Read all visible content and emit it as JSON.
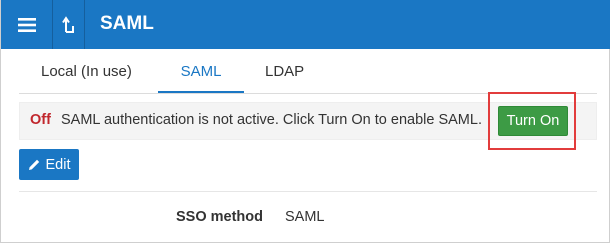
{
  "header": {
    "title": "SAML",
    "color": "#1a77c4"
  },
  "tabs": [
    {
      "label": "Local (In use)",
      "active": false
    },
    {
      "label": "SAML",
      "active": true
    },
    {
      "label": "LDAP",
      "active": false
    }
  ],
  "banner": {
    "status": "Off",
    "message": "SAML authentication is not active. Click Turn On to enable SAML.",
    "action_label": "Turn On"
  },
  "toolbar": {
    "edit_label": "Edit"
  },
  "settings": {
    "sso_method_label": "SSO method",
    "sso_method_value": "SAML"
  },
  "icons": {
    "menu": "hamburger-icon",
    "back": "back-arrow-icon",
    "edit": "pencil-icon"
  },
  "colors": {
    "accent": "#1a77c4",
    "status_off": "#c1272d",
    "turn_on": "#3d9b45",
    "highlight": "#e23c3c"
  }
}
